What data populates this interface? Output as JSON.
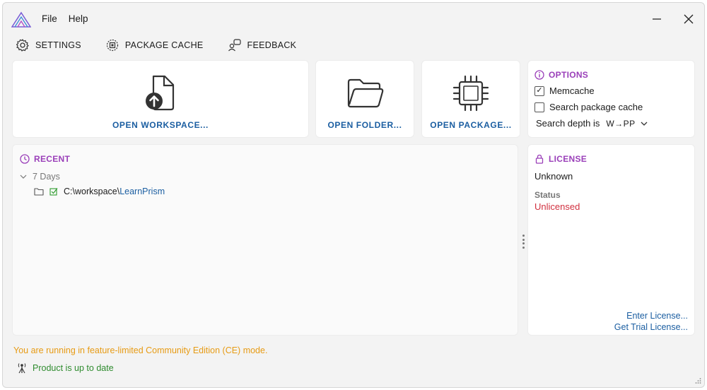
{
  "menu": {
    "file": "File",
    "help": "Help"
  },
  "toolbar": {
    "settings": "SETTINGS",
    "package_cache": "PACKAGE CACHE",
    "feedback": "FEEDBACK"
  },
  "actions": {
    "open_workspace": "OPEN WORKSPACE...",
    "open_folder": "OPEN FOLDER...",
    "open_package": "OPEN PACKAGE..."
  },
  "options": {
    "title": "OPTIONS",
    "memcache_label": "Memcache",
    "memcache_checked": true,
    "search_cache_label": "Search package cache",
    "search_cache_checked": false,
    "depth_label": "Search depth is",
    "depth_value": "W→PP"
  },
  "recent": {
    "title": "RECENT",
    "group_label": "7 Days",
    "items": [
      {
        "path_prefix": "C:\\workspace\\",
        "path_name": "LearnPrism"
      }
    ]
  },
  "license": {
    "title": "LICENSE",
    "holder": "Unknown",
    "status_label": "Status",
    "status_value": "Unlicensed",
    "enter_link": "Enter License...",
    "trial_link": "Get Trial License..."
  },
  "footer": {
    "warning": "You are running in feature-limited Community Edition (CE) mode.",
    "update_status": "Product is up to date"
  },
  "colors": {
    "accent_link": "#1b5ea1",
    "section_title": "#9a3fb9",
    "warning": "#e79b14",
    "success": "#2e8b2e",
    "error": "#d1303f"
  }
}
